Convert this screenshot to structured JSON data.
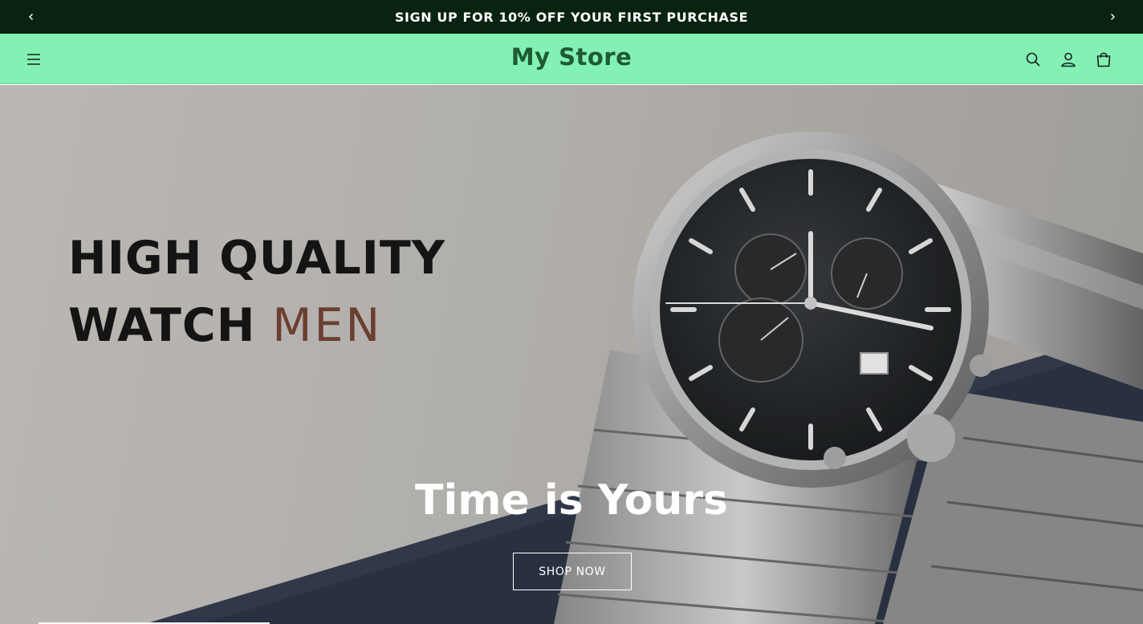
{
  "announcement": {
    "text": "SIGN UP FOR 10% OFF YOUR FIRST PURCHASE",
    "prev_icon": "chevron-left-icon",
    "next_icon": "chevron-right-icon"
  },
  "header": {
    "logo": "My Store",
    "menu_icon": "hamburger-menu-icon",
    "search_icon": "search-icon",
    "account_icon": "user-icon",
    "cart_icon": "shopping-bag-icon"
  },
  "hero": {
    "image_text_line1": "HIGH QUALITY",
    "image_text_line2a": "WATCH",
    "image_text_line2b": "MEN",
    "title": "Time is Yours",
    "button_label": "SHOP NOW"
  },
  "colors": {
    "announcement_bg": "#082310",
    "header_bg": "#83f1b4",
    "logo": "#1e5a34",
    "accent_text": "#6b3f2f"
  }
}
